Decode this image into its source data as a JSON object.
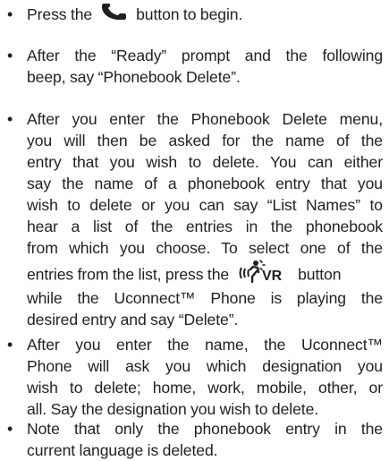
{
  "steps": [
    {
      "before_icon": "Press the",
      "icon": "phone-icon",
      "after_icon": "button to begin."
    },
    {
      "line1": "After the “Ready” prompt and the following",
      "line2": "beep, say “Phonebook Delete”."
    },
    {
      "lines": [
        "After you enter the Phonebook Delete menu,",
        "you will then be asked for the name of the",
        "entry that you wish to delete. You can either",
        "say the name of a phonebook entry that you",
        "wish to delete or you can say “List Names” to",
        "hear a list of the entries in the phonebook",
        "from which you choose. To select one of the"
      ],
      "before_icon": "entries from the list, press the",
      "icon": "voice-recognition-icon",
      "icon_label": "VR",
      "after_icon": "button",
      "tail_lines": [
        "while the Uconnect™ Phone is playing the",
        "desired entry and say “Delete”."
      ]
    },
    {
      "lines": [
        "After you enter the name, the Uconnect™",
        "Phone will ask you which designation you",
        "wish to delete; home, work, mobile, other, or",
        "all. Say the designation you wish to delete."
      ]
    },
    {
      "lines": [
        "Note that only the phonebook entry in the",
        "current language is deleted."
      ]
    }
  ],
  "bullet": "•"
}
